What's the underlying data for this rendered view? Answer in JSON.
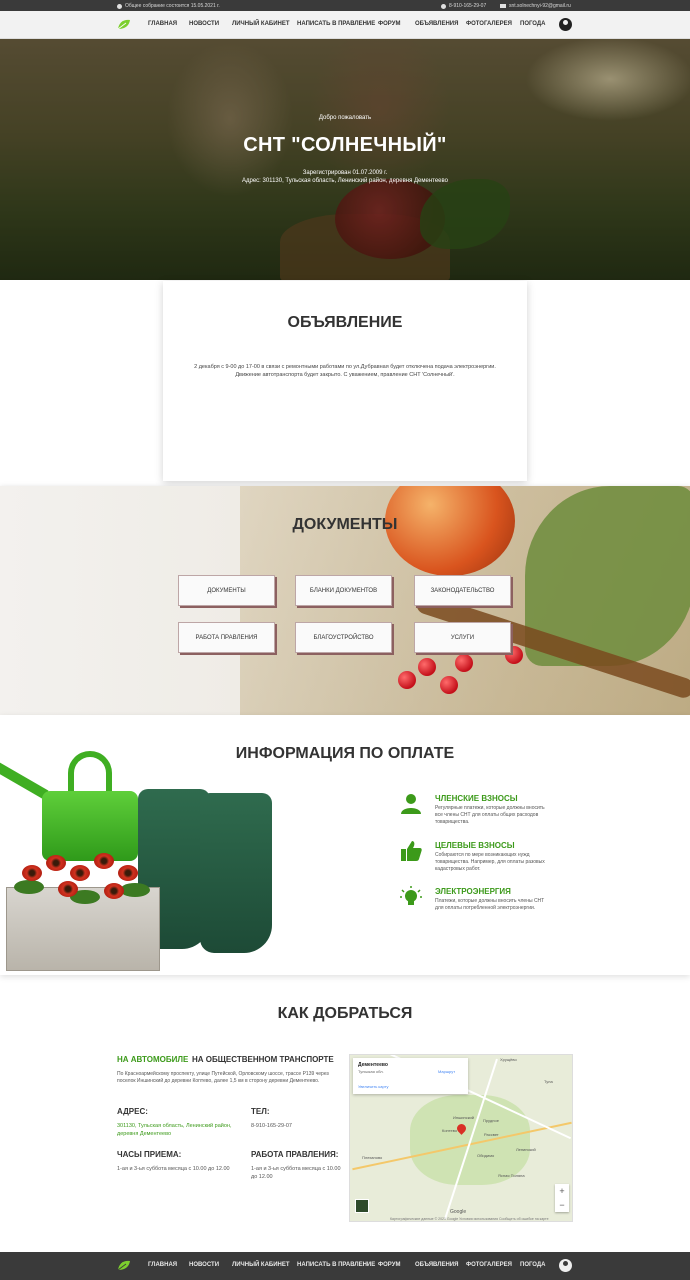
{
  "topbar": {
    "announcement": "Общее собрание состоится 15.05.2021 г.",
    "phone": "8-910-165-29-07",
    "email": "snt.solnechnyi-92@gmail.ru"
  },
  "nav": {
    "items": [
      "Главная",
      "Новости",
      "Личный кабинет",
      "Написать в правление",
      "Форум",
      "Объявления",
      "Фотогалерея",
      "Погода"
    ]
  },
  "hero": {
    "welcome": "Добро пожаловать",
    "title": "СНТ \"СОЛНЕЧНЫЙ\"",
    "registered": "Зарегистрирован 01.07.2009 г.",
    "address": "Адрес: 301130, Тульская область, Ленинский район, деревня Дементеево"
  },
  "announcement": {
    "title": "ОБЪЯВЛЕНИЕ",
    "text": "2 декабря с 9-00 до 17-00 в связи с ремонтными работами по ул.Дубравная будет отключена подача электроэнергии. Движение автотранспорта будет закрыто. С уважением, правление СНТ 'Солнечный'."
  },
  "documents": {
    "title": "ДОКУМЕНТЫ",
    "buttons": [
      "Документы",
      "Бланки документов",
      "Законодательство",
      "Работа правления",
      "Благоустройство",
      "Услуги"
    ]
  },
  "payment": {
    "title": "ИНФОРМАЦИЯ ПО ОПЛАТЕ",
    "items": [
      {
        "title": "Членские взносы",
        "text": "Регулярные платежи, которые должны вносить все члены СНТ для оплаты общих расходов товарищества.",
        "icon": "person-icon"
      },
      {
        "title": "Целевые взносы",
        "text": "Собираются по мере возникающих нужд товарищества. Например, для оплаты разовых кадастровых работ.",
        "icon": "thumbs-up-icon"
      },
      {
        "title": "Электроэнергия",
        "text": "Платежи, которые должны вносить члены СНТ для оплаты потребленной электроэнергии.",
        "icon": "lightbulb-icon"
      }
    ],
    "accent": "#3c9a1a"
  },
  "directions": {
    "title": "КАК ДОБРАТЬСЯ",
    "tabs": [
      "НА АВТОМОБИЛЕ",
      "НА ОБЩЕСТВЕННОМ ТРАНСПОРТЕ"
    ],
    "description": "По Красноармейскому проспекту, улице Путейской, Орловскому шоссе, трассе Р139 через поселок Иншинский до деревни Коптево, далее 1,5 км в сторону деревни Дементеево.",
    "address_label": "АДРЕС:",
    "address_value": "301130, Тульская область, Ленинский район, деревня Дементеево",
    "phone_label": "ТЕЛ:",
    "phone_value": "8-910-165-29-07",
    "hours_label": "ЧАСЫ ПРИЕМА:",
    "hours_value": "1-ая и 3-ья суббота месяца с 10.00 до 12.00",
    "board_label": "РАБОТА ПРАВЛЕНИЯ:",
    "board_value": "1-ая и 3-ья суббота месяца с 10.00 до 12.00"
  },
  "map": {
    "place": "Дементеево",
    "region": "Тульская обл.",
    "route": "Маршрут",
    "larger": "Увеличить карту",
    "labels": [
      "Хрущёво",
      "Тула",
      "Иншинский",
      "Коптево",
      "Прудное",
      "Рассвет",
      "Ленинский",
      "Обидимо",
      "Плеханово",
      "Ясная Поляна"
    ],
    "zoom_in": "+",
    "zoom_out": "−",
    "google": "Google",
    "footer": "Картографические данные © 2021 Google  Условия использования  Сообщить об ошибке на карте"
  }
}
